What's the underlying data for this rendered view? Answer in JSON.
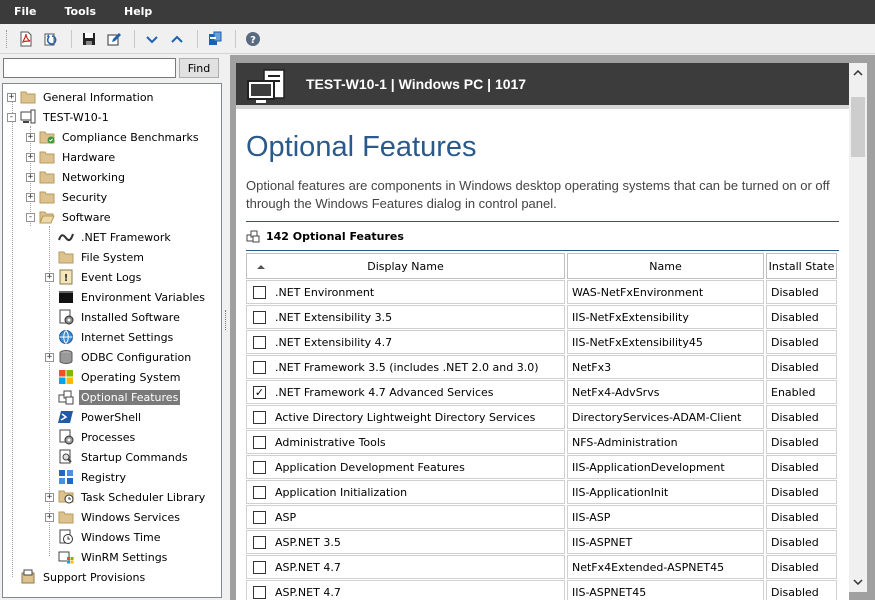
{
  "menu": {
    "file": "File",
    "tools": "Tools",
    "help": "Help"
  },
  "search": {
    "value": "",
    "find_label": "Find"
  },
  "tree": {
    "general_information": "General Information",
    "computer": "TEST-W10-1",
    "compliance_benchmarks": "Compliance Benchmarks",
    "hardware": "Hardware",
    "networking": "Networking",
    "security": "Security",
    "software": "Software",
    "net_framework": ".NET Framework",
    "file_system": "File System",
    "event_logs": "Event Logs",
    "environment_variables": "Environment Variables",
    "installed_software": "Installed Software",
    "internet_settings": "Internet Settings",
    "odbc_configuration": "ODBC Configuration",
    "operating_system": "Operating System",
    "optional_features": "Optional Features",
    "powershell": "PowerShell",
    "processes": "Processes",
    "startup_commands": "Startup Commands",
    "registry": "Registry",
    "task_scheduler_library": "Task Scheduler Library",
    "windows_services": "Windows Services",
    "windows_time": "Windows Time",
    "winrm_settings": "WinRM Settings",
    "support_provisions": "Support Provisions"
  },
  "doc": {
    "header_title": "TEST-W10-1 | Windows PC | 1017",
    "page_title": "Optional Features",
    "description": "Optional features are components in Windows desktop operating systems that can be turned on or off through the Windows Features dialog in control panel.",
    "section_title": "142 Optional Features"
  },
  "table": {
    "col_display_name": "Display Name",
    "col_name": "Name",
    "col_install_state": "Install State",
    "rows": [
      {
        "display": ".NET Environment",
        "name": "WAS-NetFxEnvironment",
        "state": "Disabled",
        "check": ""
      },
      {
        "display": ".NET Extensibility 3.5",
        "name": "IIS-NetFxExtensibility",
        "state": "Disabled",
        "check": ""
      },
      {
        "display": ".NET Extensibility 4.7",
        "name": "IIS-NetFxExtensibility45",
        "state": "Disabled",
        "check": ""
      },
      {
        "display": ".NET Framework 3.5 (includes .NET 2.0 and 3.0)",
        "name": "NetFx3",
        "state": "Disabled",
        "check": ""
      },
      {
        "display": ".NET Framework 4.7 Advanced Services",
        "name": "NetFx4-AdvSrvs",
        "state": "Enabled",
        "check": "✓"
      },
      {
        "display": "Active Directory Lightweight Directory Services",
        "name": "DirectoryServices-ADAM-Client",
        "state": "Disabled",
        "check": ""
      },
      {
        "display": "Administrative Tools",
        "name": "NFS-Administration",
        "state": "Disabled",
        "check": ""
      },
      {
        "display": "Application Development Features",
        "name": "IIS-ApplicationDevelopment",
        "state": "Disabled",
        "check": ""
      },
      {
        "display": "Application Initialization",
        "name": "IIS-ApplicationInit",
        "state": "Disabled",
        "check": ""
      },
      {
        "display": "ASP",
        "name": "IIS-ASP",
        "state": "Disabled",
        "check": ""
      },
      {
        "display": "ASP.NET 3.5",
        "name": "IIS-ASPNET",
        "state": "Disabled",
        "check": ""
      },
      {
        "display": "ASP.NET 4.7",
        "name": "NetFx4Extended-ASPNET45",
        "state": "Disabled",
        "check": ""
      },
      {
        "display": "ASP.NET 4.7",
        "name": "IIS-ASPNET45",
        "state": "Disabled",
        "check": ""
      }
    ]
  },
  "colors": {
    "menubar": "#3b3b3b",
    "title_blue": "#2b5a8a",
    "selected": "#7a7a7a"
  }
}
